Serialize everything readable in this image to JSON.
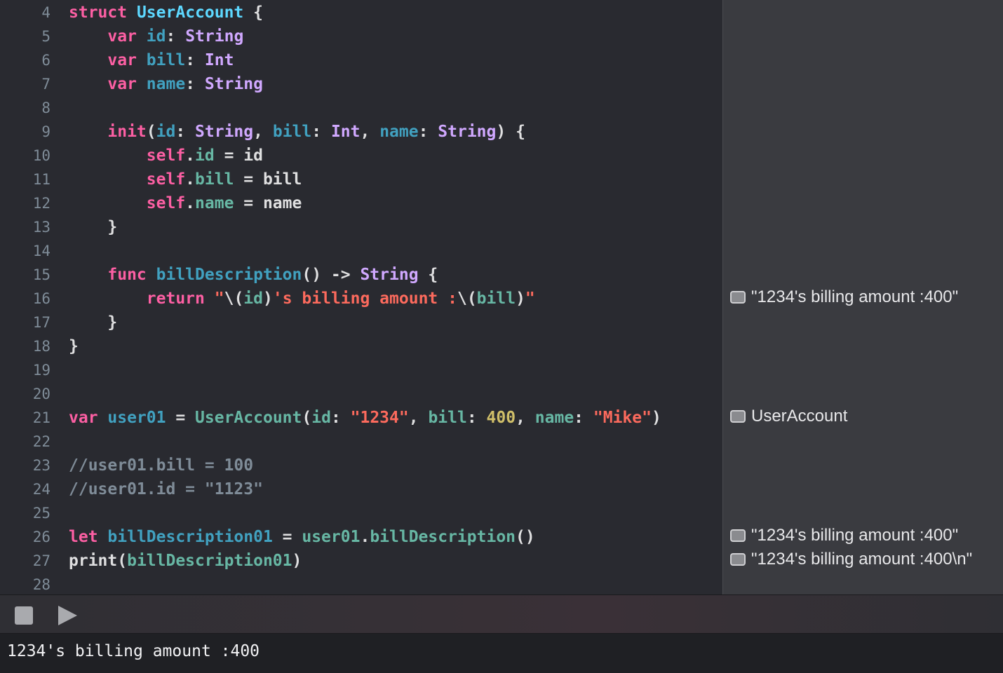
{
  "editor": {
    "lines": [
      {
        "num": "4",
        "tokens": [
          [
            "kw",
            "struct"
          ],
          [
            "pl",
            " "
          ],
          [
            "tyu",
            "UserAccount"
          ],
          [
            "pl",
            " {"
          ]
        ]
      },
      {
        "num": "5",
        "tokens": [
          [
            "pl",
            "    "
          ],
          [
            "kw",
            "var"
          ],
          [
            "pl",
            " "
          ],
          [
            "id",
            "id"
          ],
          [
            "pl",
            ": "
          ],
          [
            "ty",
            "String"
          ]
        ]
      },
      {
        "num": "6",
        "tokens": [
          [
            "pl",
            "    "
          ],
          [
            "kw",
            "var"
          ],
          [
            "pl",
            " "
          ],
          [
            "id",
            "bill"
          ],
          [
            "pl",
            ": "
          ],
          [
            "ty",
            "Int"
          ]
        ]
      },
      {
        "num": "7",
        "tokens": [
          [
            "pl",
            "    "
          ],
          [
            "kw",
            "var"
          ],
          [
            "pl",
            " "
          ],
          [
            "id",
            "name"
          ],
          [
            "pl",
            ": "
          ],
          [
            "ty",
            "String"
          ]
        ]
      },
      {
        "num": "8",
        "tokens": []
      },
      {
        "num": "9",
        "tokens": [
          [
            "pl",
            "    "
          ],
          [
            "kw",
            "init"
          ],
          [
            "pl",
            "("
          ],
          [
            "id",
            "id"
          ],
          [
            "pl",
            ": "
          ],
          [
            "ty",
            "String"
          ],
          [
            "pl",
            ", "
          ],
          [
            "id",
            "bill"
          ],
          [
            "pl",
            ": "
          ],
          [
            "ty",
            "Int"
          ],
          [
            "pl",
            ", "
          ],
          [
            "id",
            "name"
          ],
          [
            "pl",
            ": "
          ],
          [
            "ty",
            "String"
          ],
          [
            "pl",
            ") {"
          ]
        ]
      },
      {
        "num": "10",
        "tokens": [
          [
            "pl",
            "        "
          ],
          [
            "kw",
            "self"
          ],
          [
            "pl",
            "."
          ],
          [
            "mem",
            "id"
          ],
          [
            "pl",
            " = id"
          ]
        ]
      },
      {
        "num": "11",
        "tokens": [
          [
            "pl",
            "        "
          ],
          [
            "kw",
            "self"
          ],
          [
            "pl",
            "."
          ],
          [
            "mem",
            "bill"
          ],
          [
            "pl",
            " = bill"
          ]
        ]
      },
      {
        "num": "12",
        "tokens": [
          [
            "pl",
            "        "
          ],
          [
            "kw",
            "self"
          ],
          [
            "pl",
            "."
          ],
          [
            "mem",
            "name"
          ],
          [
            "pl",
            " = name"
          ]
        ]
      },
      {
        "num": "13",
        "tokens": [
          [
            "pl",
            "    }"
          ]
        ]
      },
      {
        "num": "14",
        "tokens": []
      },
      {
        "num": "15",
        "tokens": [
          [
            "pl",
            "    "
          ],
          [
            "kw",
            "func"
          ],
          [
            "pl",
            " "
          ],
          [
            "id",
            "billDescription"
          ],
          [
            "pl",
            "() -> "
          ],
          [
            "ty",
            "String"
          ],
          [
            "pl",
            " {"
          ]
        ]
      },
      {
        "num": "16",
        "tokens": [
          [
            "pl",
            "        "
          ],
          [
            "kw",
            "return"
          ],
          [
            "pl",
            " "
          ],
          [
            "str",
            "\""
          ],
          [
            "pl",
            "\\("
          ],
          [
            "mem",
            "id"
          ],
          [
            "pl",
            ")"
          ],
          [
            "str",
            "'s billing amount :"
          ],
          [
            "pl",
            "\\("
          ],
          [
            "mem",
            "bill"
          ],
          [
            "pl",
            ")"
          ],
          [
            "str",
            "\""
          ]
        ]
      },
      {
        "num": "17",
        "tokens": [
          [
            "pl",
            "    }"
          ]
        ]
      },
      {
        "num": "18",
        "tokens": [
          [
            "pl",
            "}"
          ]
        ]
      },
      {
        "num": "19",
        "tokens": []
      },
      {
        "num": "20",
        "tokens": []
      },
      {
        "num": "21",
        "tokens": [
          [
            "kw",
            "var"
          ],
          [
            "pl",
            " "
          ],
          [
            "id",
            "user01"
          ],
          [
            "pl",
            " = "
          ],
          [
            "mem",
            "UserAccount"
          ],
          [
            "pl",
            "("
          ],
          [
            "mem",
            "id"
          ],
          [
            "pl",
            ": "
          ],
          [
            "str",
            "\"1234\""
          ],
          [
            "pl",
            ", "
          ],
          [
            "mem",
            "bill"
          ],
          [
            "pl",
            ": "
          ],
          [
            "num",
            "400"
          ],
          [
            "pl",
            ", "
          ],
          [
            "mem",
            "name"
          ],
          [
            "pl",
            ": "
          ],
          [
            "str",
            "\"Mike\""
          ],
          [
            "pl",
            ")"
          ]
        ]
      },
      {
        "num": "22",
        "tokens": []
      },
      {
        "num": "23",
        "tokens": [
          [
            "cm",
            "//user01.bill = 100"
          ]
        ]
      },
      {
        "num": "24",
        "tokens": [
          [
            "cm",
            "//user01.id = \"1123\""
          ]
        ]
      },
      {
        "num": "25",
        "tokens": []
      },
      {
        "num": "26",
        "tokens": [
          [
            "kw",
            "let"
          ],
          [
            "pl",
            " "
          ],
          [
            "id",
            "billDescription01"
          ],
          [
            "pl",
            " = "
          ],
          [
            "mem",
            "user01"
          ],
          [
            "pl",
            "."
          ],
          [
            "mem",
            "billDescription"
          ],
          [
            "pl",
            "()"
          ]
        ]
      },
      {
        "num": "27",
        "tokens": [
          [
            "pl",
            "print("
          ],
          [
            "mem",
            "billDescription01"
          ],
          [
            "pl",
            ")"
          ]
        ]
      },
      {
        "num": "28",
        "tokens": []
      }
    ]
  },
  "results": [
    {
      "line": "16",
      "text": "\"1234's billing amount :400\""
    },
    {
      "line": "21",
      "text": "UserAccount"
    },
    {
      "line": "26",
      "text": "\"1234's billing amount :400\""
    },
    {
      "line": "27",
      "text": "\"1234's billing amount :400\\n\""
    }
  ],
  "toolbar": {
    "stop_icon": "stop-square-icon",
    "run_icon": "play-triangle-icon"
  },
  "console": {
    "output": "1234's billing amount :400"
  }
}
